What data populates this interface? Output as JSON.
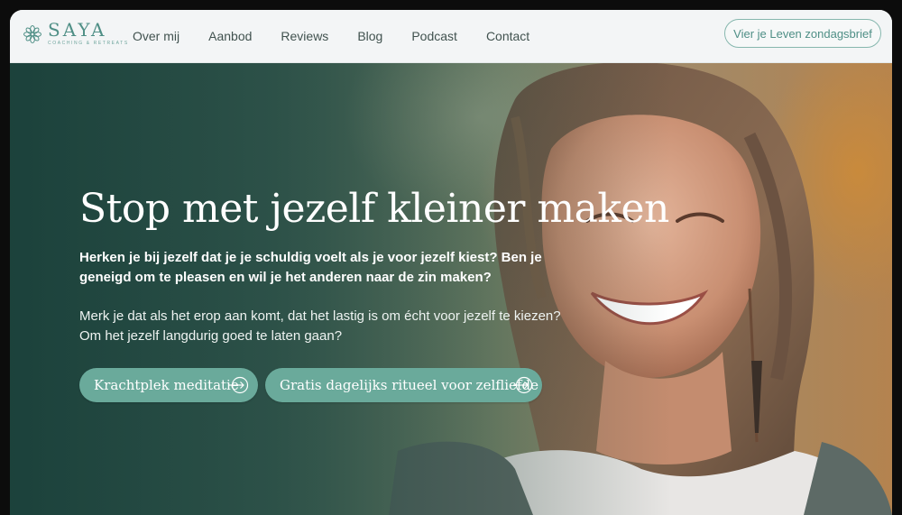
{
  "header": {
    "logo": {
      "word": "SAYA",
      "tagline": "COACHING & RETREATS",
      "icon": "mandala-icon"
    },
    "nav": [
      "Over mij",
      "Aanbod",
      "Reviews",
      "Blog",
      "Podcast",
      "Contact"
    ],
    "cta_label": "Vier je Leven zondagsbrief"
  },
  "hero": {
    "title": "Stop met jezelf kleiner maken",
    "lead": "Herken je bij jezelf dat je je schuldig voelt als je voor jezelf kiest? Ben je geneigd om te pleasen en wil je het anderen naar de zin maken?",
    "body": "Merk je dat als het erop aan komt, dat het lastig is om écht voor jezelf te kiezen? Om het jezelf langdurig goed te laten gaan?",
    "buttons": [
      {
        "label": "Krachtplek meditatie",
        "icon": "arrow-circle-icon"
      },
      {
        "label": "Gratis dagelijks ritueel voor zelfliefde",
        "icon": "arrow-circle-icon"
      }
    ],
    "image": "smiling-woman-photo"
  },
  "colors": {
    "brand": "#4f8f86",
    "button": "#6aaa9b",
    "header_bg": "#f3f5f6"
  }
}
